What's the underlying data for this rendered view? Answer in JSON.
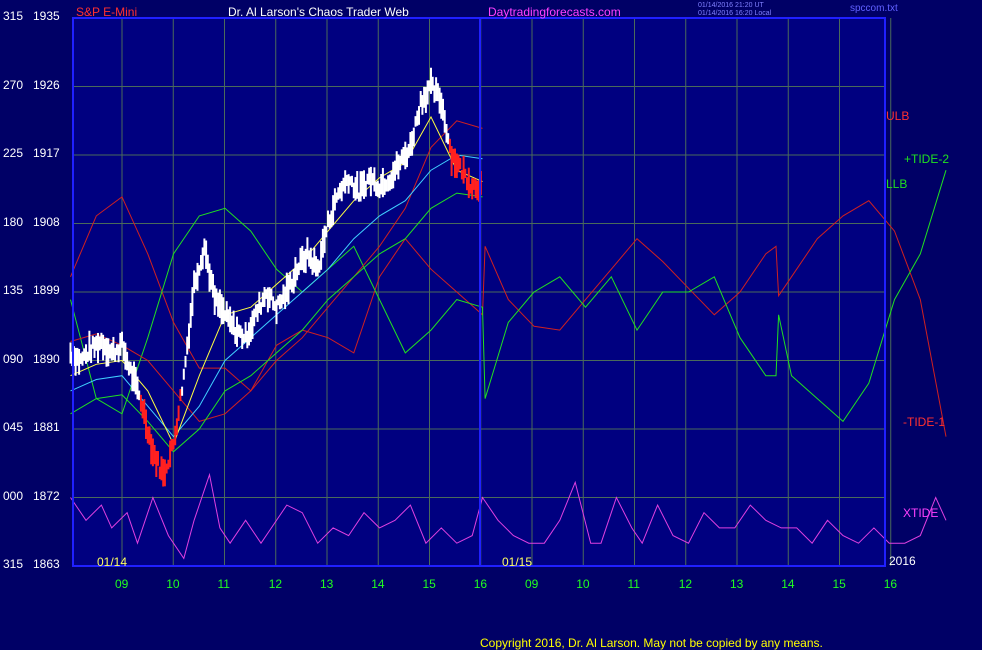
{
  "header": {
    "symbol": "S&P E-Mini",
    "title": "Dr. Al Larson's Chaos Trader Web",
    "site": "Daytradingforecasts.com",
    "stamp1": "01/14/2016 21:20 UT",
    "stamp2": "01/14/2016 16:20 Local",
    "file": "spccom.txt"
  },
  "footer": {
    "copyright": "Copyright 2016, Dr. Al Larson. May not be copied by any means."
  },
  "colors": {
    "background": "#000066",
    "plot": "#000080",
    "grid": "#4a6a5a",
    "border": "#2020ff",
    "label": "#ffffff",
    "ulb": "#d02020",
    "llb": "#20e020",
    "xtide": "#e040e0",
    "price_up": "#ffffff",
    "price_down": "#ff2020"
  },
  "chart_data": {
    "type": "line",
    "y_labels": [
      {
        "tide": "315",
        "price": "1935"
      },
      {
        "tide": "270",
        "price": "1926"
      },
      {
        "tide": "225",
        "price": "1917"
      },
      {
        "tide": "180",
        "price": "1908"
      },
      {
        "tide": "135",
        "price": "1899"
      },
      {
        "tide": "090",
        "price": "1890"
      },
      {
        "tide": "045",
        "price": "1881"
      },
      {
        "tide": "000",
        "price": "1872"
      },
      {
        "tide": "315",
        "price": "1863"
      }
    ],
    "x_ticks": [
      "09",
      "10",
      "11",
      "12",
      "13",
      "14",
      "15",
      "16",
      "09",
      "10",
      "11",
      "12",
      "13",
      "14",
      "15",
      "16"
    ],
    "date_labels": [
      "01/14",
      "01/15"
    ],
    "year_label": "2016",
    "ylim_price": [
      1863,
      1935
    ],
    "legend": {
      "ulb": "ULB",
      "llb": "LLB",
      "tide2": "+TIDE-2",
      "tide1": "-TIDE-1",
      "xtide": "XTIDE"
    },
    "ulb_day1": [
      [
        8.0,
        1892.5
      ],
      [
        8.5,
        1893.5
      ],
      [
        9.0,
        1892
      ],
      [
        9.5,
        1890
      ],
      [
        10.0,
        1886
      ],
      [
        10.5,
        1882
      ],
      [
        11.0,
        1883
      ],
      [
        11.5,
        1886
      ],
      [
        12.0,
        1890
      ],
      [
        12.5,
        1893
      ],
      [
        13.0,
        1897
      ],
      [
        13.5,
        1901
      ],
      [
        14.0,
        1905
      ],
      [
        14.5,
        1910
      ],
      [
        15.0,
        1918
      ],
      [
        15.5,
        1921.5
      ],
      [
        16.0,
        1920.5
      ]
    ],
    "llb_day1": [
      [
        8.0,
        1883
      ],
      [
        8.5,
        1885
      ],
      [
        9.0,
        1885.5
      ],
      [
        9.5,
        1882
      ],
      [
        10.0,
        1878
      ],
      [
        10.5,
        1881
      ],
      [
        11.0,
        1886
      ],
      [
        11.5,
        1888
      ],
      [
        12.0,
        1891
      ],
      [
        12.5,
        1894
      ],
      [
        13.0,
        1898
      ],
      [
        13.5,
        1901
      ],
      [
        14.0,
        1904
      ],
      [
        14.5,
        1906
      ],
      [
        15.0,
        1910
      ],
      [
        15.5,
        1912
      ],
      [
        16.0,
        1911.5
      ]
    ],
    "cyan_day1": [
      [
        8.0,
        1886
      ],
      [
        8.5,
        1887.5
      ],
      [
        9.0,
        1888
      ],
      [
        9.5,
        1884
      ],
      [
        10.0,
        1880
      ],
      [
        10.5,
        1884
      ],
      [
        11.0,
        1890
      ],
      [
        11.5,
        1893
      ],
      [
        12.0,
        1896
      ],
      [
        12.5,
        1899
      ],
      [
        13.0,
        1902
      ],
      [
        13.5,
        1906
      ],
      [
        14.0,
        1909
      ],
      [
        14.5,
        1911
      ],
      [
        15.0,
        1915
      ],
      [
        15.5,
        1917
      ],
      [
        16.0,
        1916.5
      ]
    ],
    "yellow_day1": [
      [
        8.0,
        1888
      ],
      [
        8.5,
        1889.5
      ],
      [
        9.0,
        1890
      ],
      [
        9.5,
        1886
      ],
      [
        10.0,
        1879
      ],
      [
        10.5,
        1888
      ],
      [
        11.0,
        1896
      ],
      [
        11.5,
        1897
      ],
      [
        12.0,
        1900
      ],
      [
        12.5,
        1903
      ],
      [
        13.0,
        1907
      ],
      [
        13.5,
        1911
      ],
      [
        14.0,
        1914
      ],
      [
        14.5,
        1916
      ],
      [
        15.0,
        1922
      ],
      [
        15.5,
        1915
      ],
      [
        16.0,
        1913.5
      ]
    ],
    "tide1_red": [
      [
        8.0,
        1901
      ],
      [
        8.5,
        1909
      ],
      [
        9.0,
        1911.5
      ],
      [
        9.5,
        1904
      ],
      [
        10.0,
        1895
      ],
      [
        10.5,
        1889
      ],
      [
        11.0,
        1889
      ],
      [
        11.5,
        1886
      ],
      [
        12.0,
        1892
      ],
      [
        12.5,
        1894
      ],
      [
        13.0,
        1893
      ],
      [
        13.5,
        1891
      ],
      [
        14.0,
        1901
      ],
      [
        14.5,
        1906
      ],
      [
        15.0,
        1902
      ],
      [
        15.5,
        1899
      ],
      [
        16.0,
        1896
      ],
      [
        16.05,
        1905
      ],
      [
        16.5,
        1898
      ],
      [
        17.0,
        1894.5
      ],
      [
        17.5,
        1894
      ],
      [
        18.0,
        1898
      ],
      [
        18.5,
        1902
      ],
      [
        19.0,
        1906
      ],
      [
        19.5,
        1903
      ],
      [
        20.0,
        1899.5
      ],
      [
        20.5,
        1896
      ],
      [
        21.0,
        1899
      ],
      [
        21.5,
        1904
      ],
      [
        21.7,
        1905
      ],
      [
        21.75,
        1898.5
      ],
      [
        22.0,
        1901
      ],
      [
        22.5,
        1906
      ],
      [
        23.0,
        1909
      ],
      [
        23.5,
        1911
      ],
      [
        24.0,
        1907
      ],
      [
        24.5,
        1898
      ],
      [
        25.0,
        1880
      ]
    ],
    "tide2_green": [
      [
        8.0,
        1898
      ],
      [
        8.5,
        1885
      ],
      [
        9.0,
        1883
      ],
      [
        9.5,
        1893
      ],
      [
        10.0,
        1904
      ],
      [
        10.5,
        1909
      ],
      [
        11.0,
        1910
      ],
      [
        11.5,
        1907
      ],
      [
        12.0,
        1902
      ],
      [
        12.5,
        1899
      ],
      [
        13.0,
        1902
      ],
      [
        13.5,
        1905
      ],
      [
        14.0,
        1898
      ],
      [
        14.5,
        1891
      ],
      [
        15.0,
        1894
      ],
      [
        15.5,
        1898
      ],
      [
        16.0,
        1897
      ],
      [
        16.05,
        1885
      ],
      [
        16.5,
        1895
      ],
      [
        17.0,
        1899
      ],
      [
        17.5,
        1901
      ],
      [
        18.0,
        1897
      ],
      [
        18.5,
        1901
      ],
      [
        19.0,
        1894
      ],
      [
        19.5,
        1899
      ],
      [
        20.0,
        1899
      ],
      [
        20.5,
        1901
      ],
      [
        21.0,
        1893
      ],
      [
        21.5,
        1888
      ],
      [
        21.7,
        1888
      ],
      [
        21.75,
        1896
      ],
      [
        22.0,
        1888
      ],
      [
        22.5,
        1885
      ],
      [
        23.0,
        1882
      ],
      [
        23.5,
        1887
      ],
      [
        24.0,
        1898
      ],
      [
        24.5,
        1904
      ],
      [
        25.0,
        1915
      ]
    ],
    "xtide": [
      [
        8.0,
        1872
      ],
      [
        8.3,
        1869
      ],
      [
        8.6,
        1871
      ],
      [
        8.8,
        1868
      ],
      [
        9.1,
        1870
      ],
      [
        9.3,
        1866
      ],
      [
        9.6,
        1872
      ],
      [
        9.9,
        1867
      ],
      [
        10.2,
        1864
      ],
      [
        10.4,
        1869
      ],
      [
        10.7,
        1875
      ],
      [
        10.9,
        1868
      ],
      [
        11.1,
        1866
      ],
      [
        11.4,
        1869
      ],
      [
        11.7,
        1866
      ],
      [
        11.9,
        1868
      ],
      [
        12.2,
        1871
      ],
      [
        12.5,
        1870
      ],
      [
        12.8,
        1866
      ],
      [
        13.1,
        1868
      ],
      [
        13.4,
        1867
      ],
      [
        13.7,
        1870
      ],
      [
        14.0,
        1868
      ],
      [
        14.3,
        1869
      ],
      [
        14.6,
        1871
      ],
      [
        14.9,
        1866
      ],
      [
        15.2,
        1868
      ],
      [
        15.5,
        1866
      ],
      [
        15.8,
        1867
      ],
      [
        16.0,
        1872
      ],
      [
        16.3,
        1869
      ],
      [
        16.6,
        1867
      ],
      [
        16.9,
        1866
      ],
      [
        17.2,
        1866
      ],
      [
        17.5,
        1869
      ],
      [
        17.8,
        1874
      ],
      [
        18.1,
        1866
      ],
      [
        18.3,
        1866
      ],
      [
        18.6,
        1872
      ],
      [
        18.9,
        1868
      ],
      [
        19.1,
        1866
      ],
      [
        19.4,
        1871
      ],
      [
        19.7,
        1867
      ],
      [
        20.0,
        1866
      ],
      [
        20.3,
        1870
      ],
      [
        20.6,
        1868
      ],
      [
        20.9,
        1868
      ],
      [
        21.2,
        1871
      ],
      [
        21.5,
        1869
      ],
      [
        21.8,
        1868
      ],
      [
        22.1,
        1868
      ],
      [
        22.4,
        1866
      ],
      [
        22.7,
        1869
      ],
      [
        23.0,
        1867
      ],
      [
        23.3,
        1866
      ],
      [
        23.6,
        1868
      ],
      [
        23.9,
        1866
      ],
      [
        24.2,
        1866
      ],
      [
        24.5,
        1867
      ],
      [
        24.8,
        1872
      ],
      [
        25.0,
        1869
      ]
    ],
    "price_path": [
      [
        8.0,
        1891
      ],
      [
        8.2,
        1890
      ],
      [
        8.4,
        1891.5
      ],
      [
        8.6,
        1892.5
      ],
      [
        8.8,
        1891
      ],
      [
        9.0,
        1892
      ],
      [
        9.2,
        1888
      ],
      [
        9.4,
        1884
      ],
      [
        9.6,
        1878
      ],
      [
        9.8,
        1875
      ],
      [
        10.0,
        1879
      ],
      [
        10.2,
        1888
      ],
      [
        10.4,
        1900
      ],
      [
        10.6,
        1905
      ],
      [
        10.8,
        1898
      ],
      [
        11.0,
        1896
      ],
      [
        11.2,
        1894
      ],
      [
        11.4,
        1893
      ],
      [
        11.6,
        1896
      ],
      [
        11.8,
        1899
      ],
      [
        12.0,
        1897
      ],
      [
        12.2,
        1899
      ],
      [
        12.4,
        1902
      ],
      [
        12.6,
        1904
      ],
      [
        12.8,
        1902
      ],
      [
        13.0,
        1908
      ],
      [
        13.2,
        1912
      ],
      [
        13.4,
        1914
      ],
      [
        13.6,
        1912
      ],
      [
        13.8,
        1914
      ],
      [
        14.0,
        1913
      ],
      [
        14.2,
        1914
      ],
      [
        14.4,
        1916
      ],
      [
        14.6,
        1918
      ],
      [
        14.8,
        1924
      ],
      [
        15.0,
        1926
      ],
      [
        15.2,
        1924
      ],
      [
        15.4,
        1917
      ],
      [
        15.6,
        1915
      ],
      [
        15.8,
        1913
      ],
      [
        16.0,
        1913
      ]
    ]
  }
}
